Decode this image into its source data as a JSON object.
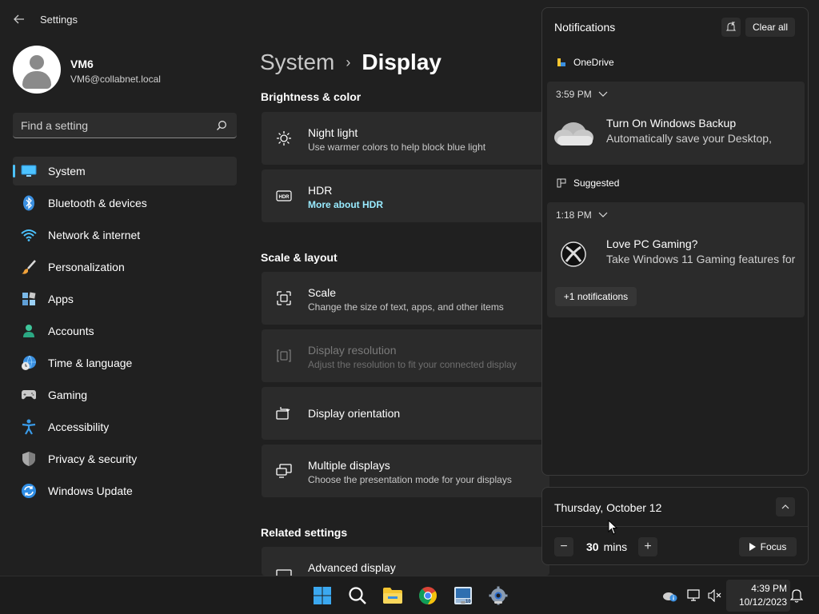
{
  "window": {
    "title": "Settings"
  },
  "profile": {
    "name": "VM6",
    "email": "VM6@collabnet.local"
  },
  "search": {
    "placeholder": "Find a setting"
  },
  "sidebar": {
    "items": [
      {
        "label": "System",
        "icon": "monitor-icon",
        "active": true
      },
      {
        "label": "Bluetooth & devices",
        "icon": "bluetooth-icon"
      },
      {
        "label": "Network & internet",
        "icon": "wifi-icon"
      },
      {
        "label": "Personalization",
        "icon": "brush-icon"
      },
      {
        "label": "Apps",
        "icon": "apps-icon"
      },
      {
        "label": "Accounts",
        "icon": "person-icon"
      },
      {
        "label": "Time & language",
        "icon": "globe-clock-icon"
      },
      {
        "label": "Gaming",
        "icon": "gamepad-icon"
      },
      {
        "label": "Accessibility",
        "icon": "accessibility-icon"
      },
      {
        "label": "Privacy & security",
        "icon": "shield-icon"
      },
      {
        "label": "Windows Update",
        "icon": "update-icon"
      }
    ]
  },
  "main": {
    "breadcrumb_parent": "System",
    "breadcrumb_current": "Display",
    "sections": {
      "brightness": "Brightness & color",
      "scale_layout": "Scale & layout",
      "related": "Related settings"
    },
    "cards": {
      "night_light": {
        "title": "Night light",
        "subtitle": "Use warmer colors to help block blue light"
      },
      "hdr": {
        "title": "HDR",
        "link": "More about HDR"
      },
      "scale": {
        "title": "Scale",
        "subtitle": "Change the size of text, apps, and other items"
      },
      "resolution": {
        "title": "Display resolution",
        "subtitle": "Adjust the resolution to fit your connected display"
      },
      "orientation": {
        "title": "Display orientation"
      },
      "multiple": {
        "title": "Multiple displays",
        "subtitle": "Choose the presentation mode for your displays"
      },
      "advanced": {
        "title": "Advanced display"
      }
    }
  },
  "notifications": {
    "title": "Notifications",
    "clear_all": "Clear all",
    "groups": [
      {
        "app": "OneDrive",
        "time": "3:59 PM",
        "title": "Turn On Windows Backup",
        "body": "Automatically save your Desktop,"
      },
      {
        "app": "Suggested",
        "time": "1:18 PM",
        "title": "Love PC Gaming?",
        "body": "Take Windows 11 Gaming features for",
        "more": "+1 notifications"
      }
    ]
  },
  "calendar": {
    "date": "Thursday, October 12",
    "focus_value": "30",
    "focus_unit": "mins",
    "focus_label": "Focus"
  },
  "taskbar": {
    "time": "4:39 PM",
    "date": "10/12/2023"
  },
  "colors": {
    "accent": "#4cc2ff",
    "link": "#99ebff",
    "background": "#202020",
    "card": "#2b2b2b"
  }
}
